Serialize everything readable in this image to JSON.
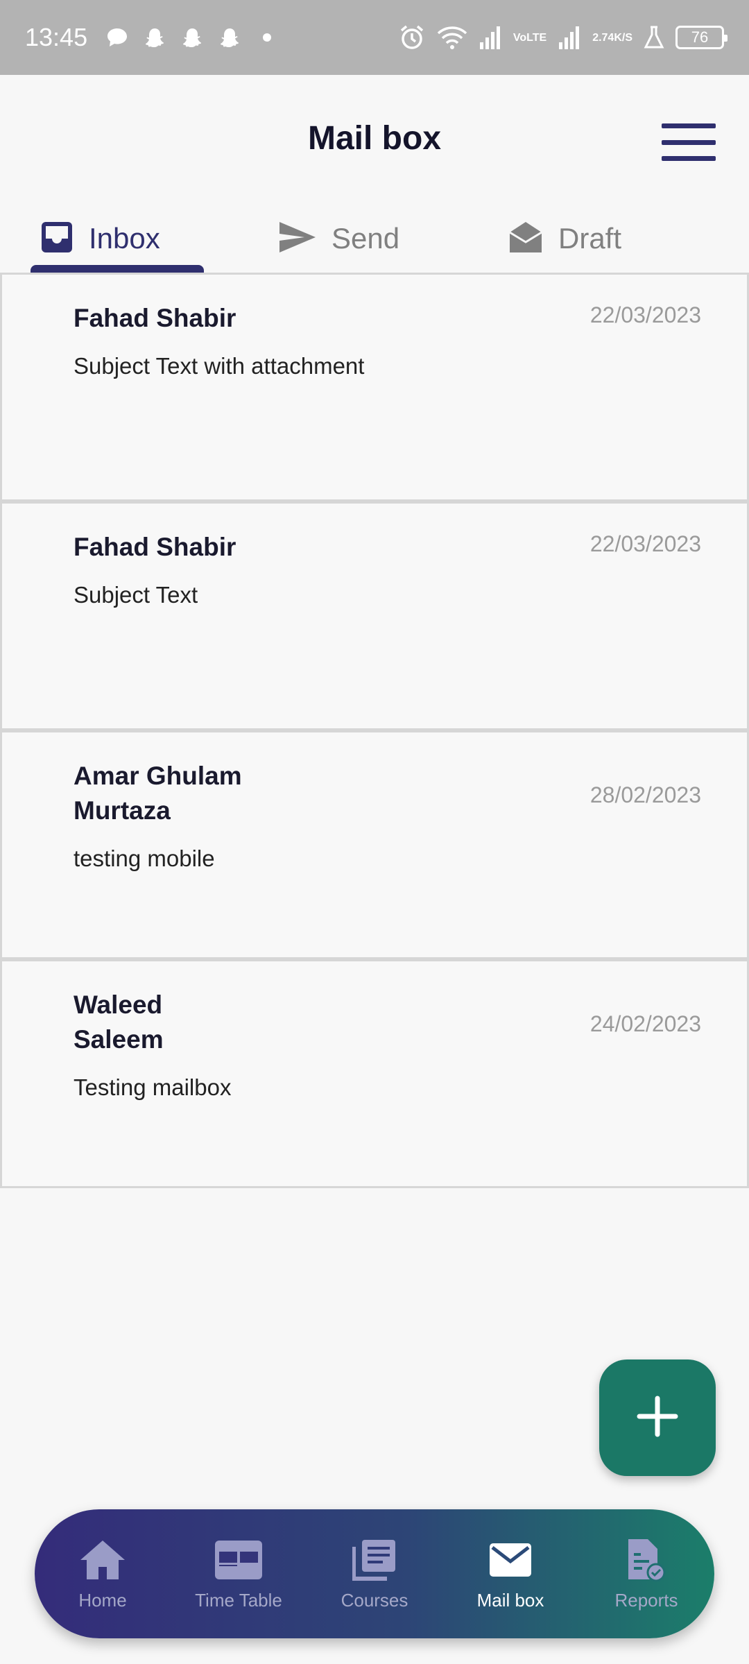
{
  "status_bar": {
    "time": "13:45",
    "net_speed_value": "2.74",
    "net_speed_unit": "K/S",
    "volte_top": "Vo",
    "volte_bottom": "LTE",
    "battery": "76"
  },
  "header": {
    "title": "Mail box",
    "menu_icon": "hamburger-menu-icon"
  },
  "tabs": [
    {
      "label": "Inbox",
      "icon": "inbox-tray-icon",
      "active": true
    },
    {
      "label": "Send",
      "icon": "send-icon",
      "active": false
    },
    {
      "label": "Draft",
      "icon": "open-envelope-icon",
      "active": false
    }
  ],
  "mails": [
    {
      "sender": "Fahad Shabir",
      "date": "22/03/2023",
      "subject": "Subject Text with attachment"
    },
    {
      "sender": "Fahad Shabir",
      "date": "22/03/2023",
      "subject": "Subject Text"
    },
    {
      "sender": "Amar Ghulam Murtaza",
      "date": "28/02/2023",
      "subject": "testing mobile"
    },
    {
      "sender": "Waleed Saleem",
      "date": "24/02/2023",
      "subject": "Testing mailbox"
    }
  ],
  "fab": {
    "icon": "plus-icon"
  },
  "bottom_nav": [
    {
      "label": "Home",
      "icon": "home-icon",
      "active": false
    },
    {
      "label": "Time Table",
      "icon": "grid-table-icon",
      "active": false
    },
    {
      "label": "Courses",
      "icon": "library-books-icon",
      "active": false
    },
    {
      "label": "Mail box",
      "icon": "mail-icon",
      "active": true
    },
    {
      "label": "Reports",
      "icon": "report-document-icon",
      "active": false
    }
  ],
  "colors": {
    "primary": "#2f2f6e",
    "accent": "#1b7866",
    "status_bar": "#b3b3b3",
    "inactive_text": "#808080"
  }
}
